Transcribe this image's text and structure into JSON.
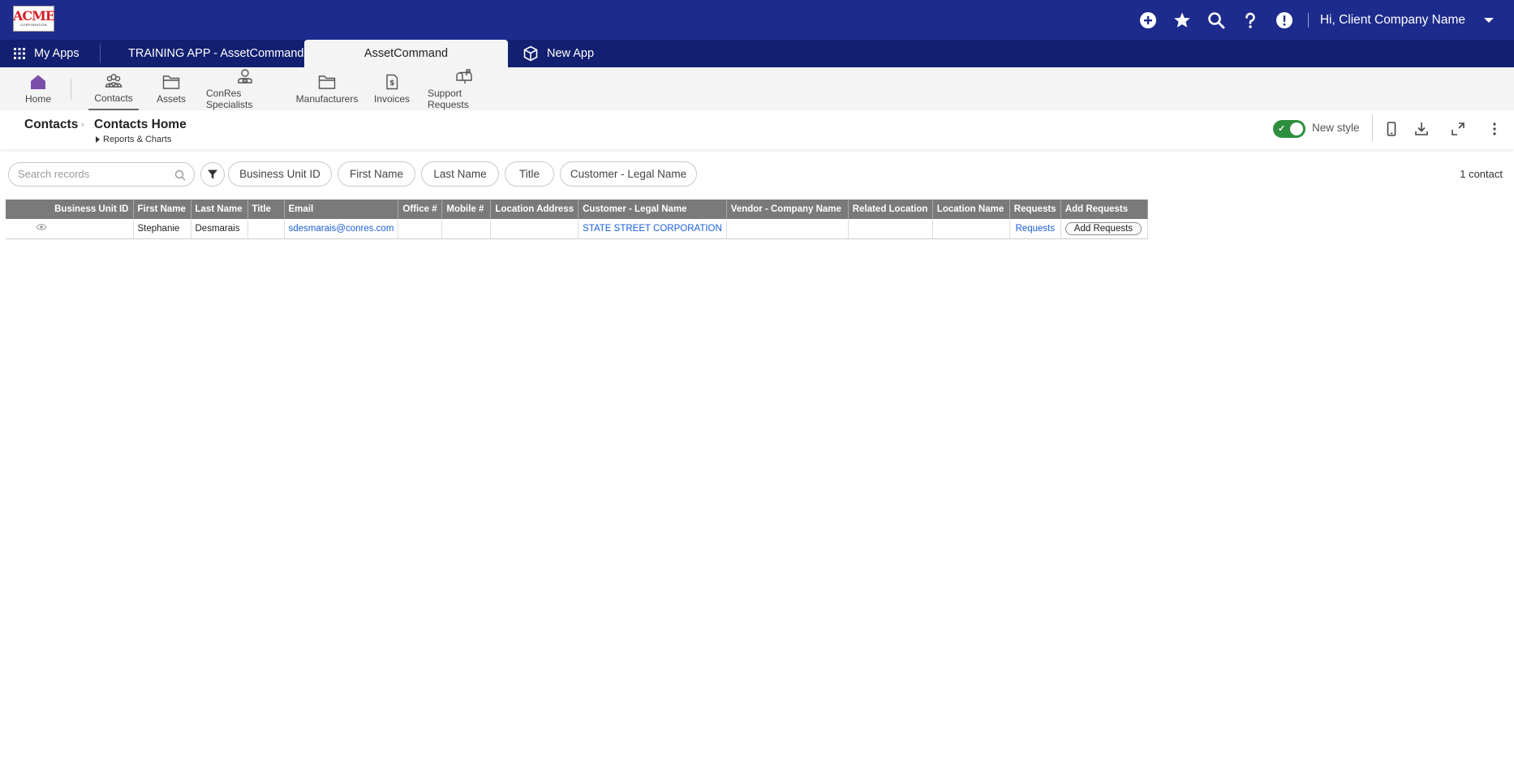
{
  "global": {
    "logo_text": "ACME",
    "logo_subtext": "CORPORATION",
    "user_greeting": "Hi, Client Company Name"
  },
  "app_tabs": {
    "my_apps": "My Apps",
    "training": "TRAINING APP - AssetCommand",
    "active": "AssetCommand",
    "new_app": "New App"
  },
  "nav": {
    "home": "Home",
    "contacts": "Contacts",
    "assets": "Assets",
    "specialists": "ConRes Specialists",
    "manufacturers": "Manufacturers",
    "invoices": "Invoices",
    "support": "Support Requests"
  },
  "header": {
    "root": "Contacts",
    "title": "Contacts Home",
    "reports": "Reports & Charts",
    "toggle_label": "New style"
  },
  "filters": {
    "search_placeholder": "Search records",
    "chips": [
      "Business Unit ID",
      "First Name",
      "Last Name",
      "Title",
      "Customer - Legal Name"
    ],
    "count": "1 contact"
  },
  "table": {
    "columns": [
      "Business Unit ID",
      "First Name",
      "Last Name",
      "Title",
      "Email",
      "Office #",
      "Mobile #",
      "Location Address",
      "Customer - Legal Name",
      "Vendor - Company Name",
      "Related Location",
      "Location Name",
      "Requests",
      "Add Requests"
    ],
    "rows": [
      {
        "business_unit_id": "",
        "first_name": "Stephanie",
        "last_name": "Desmarais",
        "title": "",
        "email": "sdesmarais@conres.com",
        "office": "",
        "mobile": "",
        "location_address": "",
        "customer": "STATE STREET CORPORATION",
        "vendor": "",
        "related_location": "",
        "location_name": "",
        "requests": "Requests",
        "add_requests": "Add Requests"
      }
    ]
  },
  "colors": {
    "global_bar": "#1d2b8c",
    "app_tab_bar": "#131f70",
    "nav_bg": "#f4f4f5",
    "home_icon": "#7b4fa8",
    "toggle_on": "#2d8f3d",
    "table_header": "#7a7a7a",
    "link": "#1a5fd8"
  },
  "icons": {
    "global": [
      "plus-circle-icon",
      "star-icon",
      "search-icon",
      "question-icon",
      "alert-icon",
      "caret-down-icon"
    ],
    "header": [
      "mobile-icon",
      "download-icon",
      "expand-icon",
      "more-vertical-icon"
    ]
  }
}
